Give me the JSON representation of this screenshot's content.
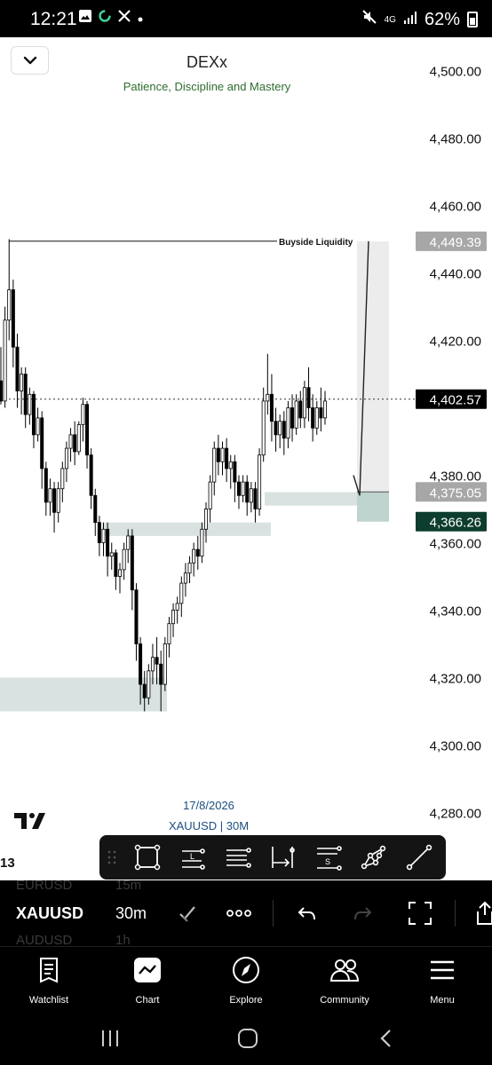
{
  "status_bar": {
    "time": "12:21",
    "network": "4G",
    "battery": "62%",
    "icons": [
      "image-icon",
      "sync-icon",
      "x-app-icon",
      "dot-icon",
      "mute-icon",
      "signal-icon",
      "battery-icon"
    ]
  },
  "header": {
    "title": "DEXx",
    "subtitle": "Patience,  Discipline and Mastery"
  },
  "chart_data": {
    "type": "candlestick",
    "symbol": "XAUUSD",
    "interval": "30M",
    "price_axis_ticks": [
      "4,500.00",
      "4,480.00",
      "4,460.00",
      "4,440.00",
      "4,420.00",
      "4,380.00",
      "4,360.00",
      "4,340.00",
      "4,320.00",
      "4,300.00",
      "4,280.00"
    ],
    "ylim": [
      4270,
      4505
    ],
    "current_price": "4,402.57",
    "price_labels": [
      {
        "text": "4,449.39",
        "price": 4449.39,
        "style": "grey"
      },
      {
        "text": "4,402.57",
        "price": 4402.57,
        "style": "black"
      },
      {
        "text": "4,375.05",
        "price": 4375.05,
        "style": "grey"
      },
      {
        "text": "4,366.26",
        "price": 4366.26,
        "style": "green"
      }
    ],
    "annotations": [
      {
        "text": "Buyside Liquidity",
        "price": 4449.4
      }
    ],
    "zones": [
      {
        "name": "demand-zone-low",
        "from": 4310,
        "to": 4320
      },
      {
        "name": "demand-zone-mid",
        "from": 4362,
        "to": 4366
      },
      {
        "name": "demand-zone-right",
        "from": 4371,
        "to": 4375
      },
      {
        "name": "long-position",
        "from": 4366.26,
        "to": 4449.39
      }
    ],
    "candles": [
      {
        "o": 4408,
        "h": 4418,
        "c": 4402,
        "l": 4401
      },
      {
        "o": 4402,
        "h": 4430,
        "c": 4426,
        "l": 4400
      },
      {
        "o": 4426,
        "h": 4450,
        "c": 4435,
        "l": 4420
      },
      {
        "o": 4435,
        "h": 4438,
        "c": 4418,
        "l": 4412
      },
      {
        "o": 4418,
        "h": 4422,
        "c": 4405,
        "l": 4400
      },
      {
        "o": 4405,
        "h": 4412,
        "c": 4410,
        "l": 4398
      },
      {
        "o": 4410,
        "h": 4412,
        "c": 4398,
        "l": 4394
      },
      {
        "o": 4398,
        "h": 4406,
        "c": 4404,
        "l": 4395
      },
      {
        "o": 4404,
        "h": 4405,
        "c": 4392,
        "l": 4388
      },
      {
        "o": 4392,
        "h": 4400,
        "c": 4397,
        "l": 4390
      },
      {
        "o": 4397,
        "h": 4399,
        "c": 4382,
        "l": 4376
      },
      {
        "o": 4382,
        "h": 4384,
        "c": 4372,
        "l": 4368
      },
      {
        "o": 4372,
        "h": 4379,
        "c": 4376,
        "l": 4368
      },
      {
        "o": 4376,
        "h": 4378,
        "c": 4369,
        "l": 4363
      },
      {
        "o": 4369,
        "h": 4378,
        "c": 4376,
        "l": 4366
      },
      {
        "o": 4376,
        "h": 4384,
        "c": 4382,
        "l": 4372
      },
      {
        "o": 4382,
        "h": 4390,
        "c": 4388,
        "l": 4378
      },
      {
        "o": 4388,
        "h": 4394,
        "c": 4392,
        "l": 4384
      },
      {
        "o": 4392,
        "h": 4396,
        "c": 4387,
        "l": 4383
      },
      {
        "o": 4387,
        "h": 4396,
        "c": 4395,
        "l": 4386
      },
      {
        "o": 4395,
        "h": 4403,
        "c": 4401,
        "l": 4390
      },
      {
        "o": 4401,
        "h": 4402,
        "c": 4386,
        "l": 4382
      },
      {
        "o": 4386,
        "h": 4388,
        "c": 4374,
        "l": 4370
      },
      {
        "o": 4374,
        "h": 4376,
        "c": 4366,
        "l": 4362
      },
      {
        "o": 4366,
        "h": 4368,
        "c": 4360,
        "l": 4356
      },
      {
        "o": 4360,
        "h": 4366,
        "c": 4364,
        "l": 4356
      },
      {
        "o": 4364,
        "h": 4366,
        "c": 4356,
        "l": 4350
      },
      {
        "o": 4356,
        "h": 4360,
        "c": 4357,
        "l": 4352
      },
      {
        "o": 4357,
        "h": 4358,
        "c": 4350,
        "l": 4346
      },
      {
        "o": 4350,
        "h": 4354,
        "c": 4352,
        "l": 4345
      },
      {
        "o": 4352,
        "h": 4360,
        "c": 4358,
        "l": 4349
      },
      {
        "o": 4358,
        "h": 4364,
        "c": 4362,
        "l": 4354
      },
      {
        "o": 4362,
        "h": 4364,
        "c": 4346,
        "l": 4340
      },
      {
        "o": 4346,
        "h": 4348,
        "c": 4330,
        "l": 4325
      },
      {
        "o": 4330,
        "h": 4332,
        "c": 4318,
        "l": 4312
      },
      {
        "o": 4318,
        "h": 4322,
        "c": 4314,
        "l": 4310
      },
      {
        "o": 4314,
        "h": 4324,
        "c": 4322,
        "l": 4312
      },
      {
        "o": 4322,
        "h": 4330,
        "c": 4326,
        "l": 4318
      },
      {
        "o": 4326,
        "h": 4332,
        "c": 4324,
        "l": 4318
      },
      {
        "o": 4324,
        "h": 4328,
        "c": 4318,
        "l": 4310
      },
      {
        "o": 4318,
        "h": 4332,
        "c": 4330,
        "l": 4316
      },
      {
        "o": 4330,
        "h": 4338,
        "c": 4336,
        "l": 4326
      },
      {
        "o": 4336,
        "h": 4342,
        "c": 4340,
        "l": 4332
      },
      {
        "o": 4340,
        "h": 4344,
        "c": 4342,
        "l": 4336
      },
      {
        "o": 4342,
        "h": 4350,
        "c": 4348,
        "l": 4338
      },
      {
        "o": 4348,
        "h": 4354,
        "c": 4351,
        "l": 4344
      },
      {
        "o": 4351,
        "h": 4356,
        "c": 4354,
        "l": 4348
      },
      {
        "o": 4354,
        "h": 4360,
        "c": 4358,
        "l": 4350
      },
      {
        "o": 4358,
        "h": 4362,
        "c": 4356,
        "l": 4352
      },
      {
        "o": 4356,
        "h": 4366,
        "c": 4364,
        "l": 4354
      },
      {
        "o": 4364,
        "h": 4372,
        "c": 4370,
        "l": 4360
      },
      {
        "o": 4370,
        "h": 4380,
        "c": 4378,
        "l": 4366
      },
      {
        "o": 4378,
        "h": 4390,
        "c": 4388,
        "l": 4374
      },
      {
        "o": 4388,
        "h": 4392,
        "c": 4384,
        "l": 4380
      },
      {
        "o": 4384,
        "h": 4390,
        "c": 4388,
        "l": 4380
      },
      {
        "o": 4388,
        "h": 4391,
        "c": 4382,
        "l": 4378
      },
      {
        "o": 4382,
        "h": 4386,
        "c": 4384,
        "l": 4376
      },
      {
        "o": 4384,
        "h": 4386,
        "c": 4378,
        "l": 4372
      },
      {
        "o": 4378,
        "h": 4380,
        "c": 4374,
        "l": 4370
      },
      {
        "o": 4374,
        "h": 4380,
        "c": 4378,
        "l": 4372
      },
      {
        "o": 4378,
        "h": 4380,
        "c": 4372,
        "l": 4368
      },
      {
        "o": 4372,
        "h": 4378,
        "c": 4376,
        "l": 4369
      },
      {
        "o": 4376,
        "h": 4378,
        "c": 4370,
        "l": 4366
      },
      {
        "o": 4370,
        "h": 4388,
        "c": 4386,
        "l": 4368
      },
      {
        "o": 4386,
        "h": 4406,
        "c": 4402,
        "l": 4384
      },
      {
        "o": 4402,
        "h": 4416,
        "c": 4404,
        "l": 4398
      },
      {
        "o": 4404,
        "h": 4410,
        "c": 4396,
        "l": 4390
      },
      {
        "o": 4396,
        "h": 4400,
        "c": 4392,
        "l": 4387
      },
      {
        "o": 4392,
        "h": 4398,
        "c": 4396,
        "l": 4388
      },
      {
        "o": 4396,
        "h": 4399,
        "c": 4391,
        "l": 4386
      },
      {
        "o": 4391,
        "h": 4402,
        "c": 4400,
        "l": 4388
      },
      {
        "o": 4400,
        "h": 4404,
        "c": 4394,
        "l": 4390
      },
      {
        "o": 4394,
        "h": 4404,
        "c": 4402,
        "l": 4392
      },
      {
        "o": 4402,
        "h": 4405,
        "c": 4397,
        "l": 4394
      },
      {
        "o": 4397,
        "h": 4408,
        "c": 4406,
        "l": 4394
      },
      {
        "o": 4406,
        "h": 4412,
        "c": 4400,
        "l": 4396
      },
      {
        "o": 4400,
        "h": 4404,
        "c": 4394,
        "l": 4390
      },
      {
        "o": 4394,
        "h": 4402,
        "c": 4400,
        "l": 4392
      },
      {
        "o": 4400,
        "h": 4406,
        "c": 4397,
        "l": 4393
      },
      {
        "o": 4397,
        "h": 4405,
        "c": 4402,
        "l": 4395
      }
    ]
  },
  "footer": {
    "date": "17/8/2026",
    "symbol_interval": "XAUUSD | 30M",
    "edge_number": "13"
  },
  "drawing_toolbar": {
    "tools": [
      "rectangle-tool",
      "long-position-tool",
      "parallel-lines-tool",
      "date-range-tool",
      "signal-lines-tool",
      "pattern-tool",
      "trend-line-tool"
    ]
  },
  "symbol_bar": {
    "symbol": "XAUUSD",
    "interval": "30m",
    "ghost_above": {
      "symbol": "EURUSD",
      "interval": "15m"
    },
    "ghost_below": {
      "symbol": "AUDUSD",
      "interval": "1h"
    }
  },
  "bottom_nav": {
    "items": [
      {
        "label": "Watchlist"
      },
      {
        "label": "Chart"
      },
      {
        "label": "Explore"
      },
      {
        "label": "Community"
      },
      {
        "label": "Menu"
      }
    ]
  },
  "colors": {
    "zone": "#d9e2e1",
    "long_zone": "#ececec",
    "green_label": "#0d3d2e",
    "grey_label": "#a7a7a7",
    "subtitle": "#2f6d2f"
  }
}
